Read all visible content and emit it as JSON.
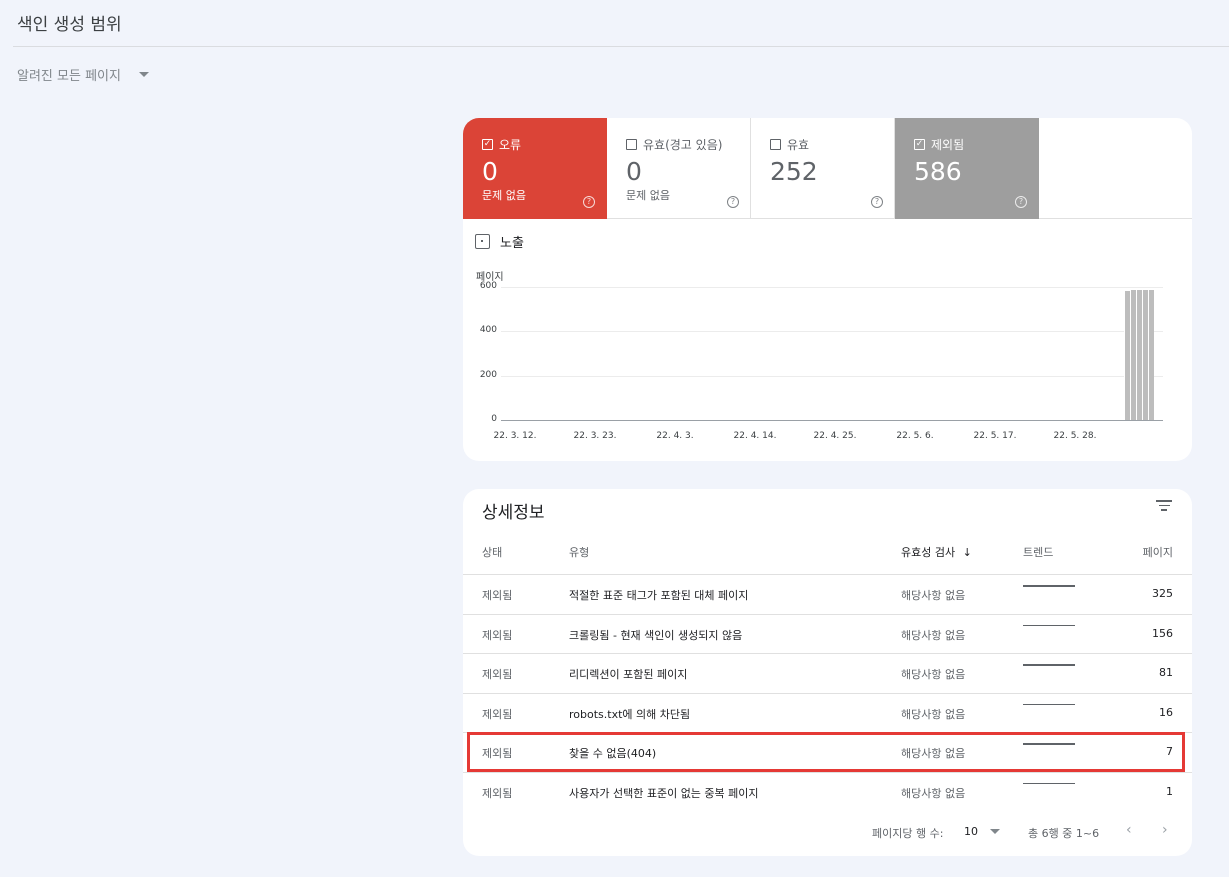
{
  "header": {
    "title": "색인 생성 범위",
    "filter_label": "알려진 모든 페이지"
  },
  "tiles": [
    {
      "label": "오류",
      "value": "0",
      "sub": "문제 없음",
      "checked": true,
      "color": "#db4437"
    },
    {
      "label": "유효(경고 있음)",
      "value": "0",
      "sub": "문제 없음",
      "checked": false
    },
    {
      "label": "유효",
      "value": "252",
      "sub": "",
      "checked": false
    },
    {
      "label": "제외됨",
      "value": "586",
      "sub": "",
      "checked": true,
      "color": "#9e9e9e"
    }
  ],
  "impressions_label": "노출",
  "chart_data": {
    "type": "bar",
    "ylabel": "페이지",
    "ylim": [
      0,
      600
    ],
    "yticks": [
      "0",
      "200",
      "400",
      "600"
    ],
    "xticks": [
      "22. 3. 12.",
      "22. 3. 23.",
      "22. 4. 3.",
      "22. 4. 14.",
      "22. 4. 25.",
      "22. 5. 6.",
      "22. 5. 17.",
      "22. 5. 28."
    ],
    "series": [
      {
        "values": [
          583,
          585,
          586,
          586,
          586
        ]
      }
    ],
    "color": "#bdbdbd"
  },
  "details": {
    "title": "상세정보",
    "columns": {
      "status": "상태",
      "type": "유형",
      "validation": "유효성 검사",
      "trend": "트렌드",
      "pages": "페이지"
    },
    "rows": [
      {
        "status": "제외됨",
        "type": "적절한 표준 태그가 포함된 대체 페이지",
        "validation": "해당사항 없음",
        "pages": "325"
      },
      {
        "status": "제외됨",
        "type": "크롤링됨 - 현재 색인이 생성되지 않음",
        "validation": "해당사항 없음",
        "pages": "156"
      },
      {
        "status": "제외됨",
        "type": "리디렉션이 포함된 페이지",
        "validation": "해당사항 없음",
        "pages": "81"
      },
      {
        "status": "제외됨",
        "type": "robots.txt에 의해 차단됨",
        "validation": "해당사항 없음",
        "pages": "16"
      },
      {
        "status": "제외됨",
        "type": "찾을 수 없음(404)",
        "validation": "해당사항 없음",
        "pages": "7"
      },
      {
        "status": "제외됨",
        "type": "사용자가 선택한 표준이 없는 중복 페이지",
        "validation": "해당사항 없음",
        "pages": "1"
      }
    ],
    "footer": {
      "rows_per_page_label": "페이지당 행 수:",
      "rows_per_page": "10",
      "range": "총 6행 중 1~6"
    }
  }
}
